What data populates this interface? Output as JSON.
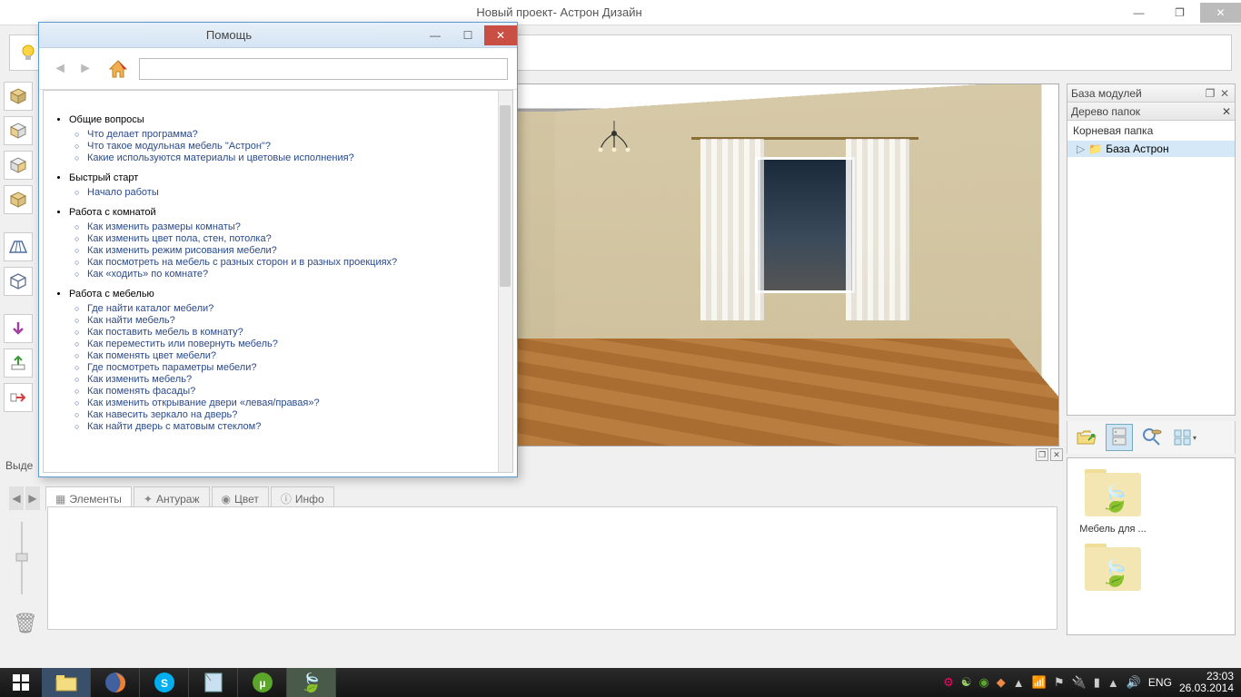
{
  "titlebar": {
    "title": "Новый проект- Астрон Дизайн"
  },
  "left_label": "Выде",
  "bottom_tabs": {
    "t1": "Элементы",
    "t2": "Антураж",
    "t3": "Цвет",
    "t4": "Инфо"
  },
  "right_panel": {
    "header": "База модулей",
    "subheader": "Дерево папок",
    "root": "Корневая папка",
    "item1": "База Астрон"
  },
  "right_bottom": {
    "folder1": "Мебель для ..."
  },
  "help": {
    "title": "Помощь",
    "sections": [
      {
        "heading": "Общие вопросы",
        "links": [
          "Что делает программа?",
          "Что такое модульная мебель \"Астрон\"?",
          "Какие используются материалы и цветовые исполнения?"
        ]
      },
      {
        "heading": "Быстрый старт",
        "links": [
          "Начало работы"
        ]
      },
      {
        "heading": "Работа с комнатой",
        "links": [
          "Как изменить размеры комнаты?",
          "Как изменить цвет пола, стен, потолка?",
          "Как изменить режим рисования мебели?",
          "Как посмотреть на мебель с разных сторон и в разных проекциях?",
          "Как «ходить» по комнате?"
        ]
      },
      {
        "heading": "Работа с мебелью",
        "links": [
          "Где найти каталог мебели?",
          "Как найти мебель?",
          "Как поставить мебель в комнату?",
          "Как переместить или повернуть мебель?",
          "Как поменять цвет мебели?",
          "Где посмотреть параметры мебели?",
          "Как изменить мебель?",
          "Как поменять фасады?",
          "Как изменить открывание двери «левая/правая»?",
          "Как навесить зеркало на дверь?",
          "Как найти дверь с матовым стеклом?"
        ]
      }
    ]
  },
  "taskbar": {
    "lang": "ENG",
    "time": "23:03",
    "date": "26.03.2014"
  }
}
